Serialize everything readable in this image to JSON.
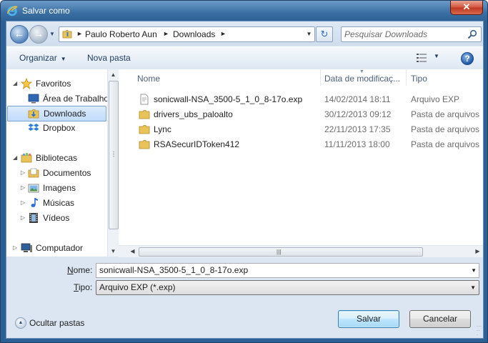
{
  "window": {
    "title": "Salvar como",
    "close_glyph": "✕"
  },
  "address_bar": {
    "crumbs": [
      "Paulo Roberto Aun",
      "Downloads"
    ],
    "search_placeholder": "Pesquisar Downloads"
  },
  "toolbar": {
    "organize_label": "Organizar",
    "new_folder_label": "Nova pasta",
    "help_glyph": "?"
  },
  "sidebar": {
    "items": [
      {
        "label": "Favoritos",
        "icon": "star-icon"
      },
      {
        "label": "Área de Trabalho",
        "icon": "desktop-icon"
      },
      {
        "label": "Downloads",
        "icon": "downloads-folder-icon",
        "selected": true
      },
      {
        "label": "Dropbox",
        "icon": "dropbox-icon"
      },
      {
        "label": "Bibliotecas",
        "icon": "libraries-icon"
      },
      {
        "label": "Documentos",
        "icon": "documents-icon"
      },
      {
        "label": "Imagens",
        "icon": "images-icon"
      },
      {
        "label": "Músicas",
        "icon": "music-icon"
      },
      {
        "label": "Vídeos",
        "icon": "videos-icon"
      },
      {
        "label": "Computador",
        "icon": "computer-icon"
      }
    ]
  },
  "file_list": {
    "columns": [
      "Nome",
      "Data de modificaç...",
      "Tipo"
    ],
    "rows": [
      {
        "name": "sonicwall-NSA_3500-5_1_0_8-17o.exp",
        "date": "14/02/2014 18:11",
        "type": "Arquivo EXP",
        "icon": "document-icon"
      },
      {
        "name": "drivers_ubs_paloalto",
        "date": "30/12/2013 09:12",
        "type": "Pasta de arquivos",
        "icon": "folder-icon"
      },
      {
        "name": "Lync",
        "date": "22/11/2013 17:35",
        "type": "Pasta de arquivos",
        "icon": "folder-icon"
      },
      {
        "name": "RSASecurIDToken412",
        "date": "11/11/2013 18:00",
        "type": "Pasta de arquivos",
        "icon": "folder-icon"
      }
    ]
  },
  "form": {
    "name_label_prefix": "N",
    "name_label_rest": "ome:",
    "name_value": "sonicwall-NSA_3500-5_1_0_8-17o.exp",
    "type_label_prefix": "T",
    "type_label_rest": "ipo:",
    "type_value": "Arquivo EXP (*.exp)",
    "hide_folders_label": "Ocultar pastas",
    "save_label": "Salvar",
    "cancel_label": "Cancelar"
  }
}
